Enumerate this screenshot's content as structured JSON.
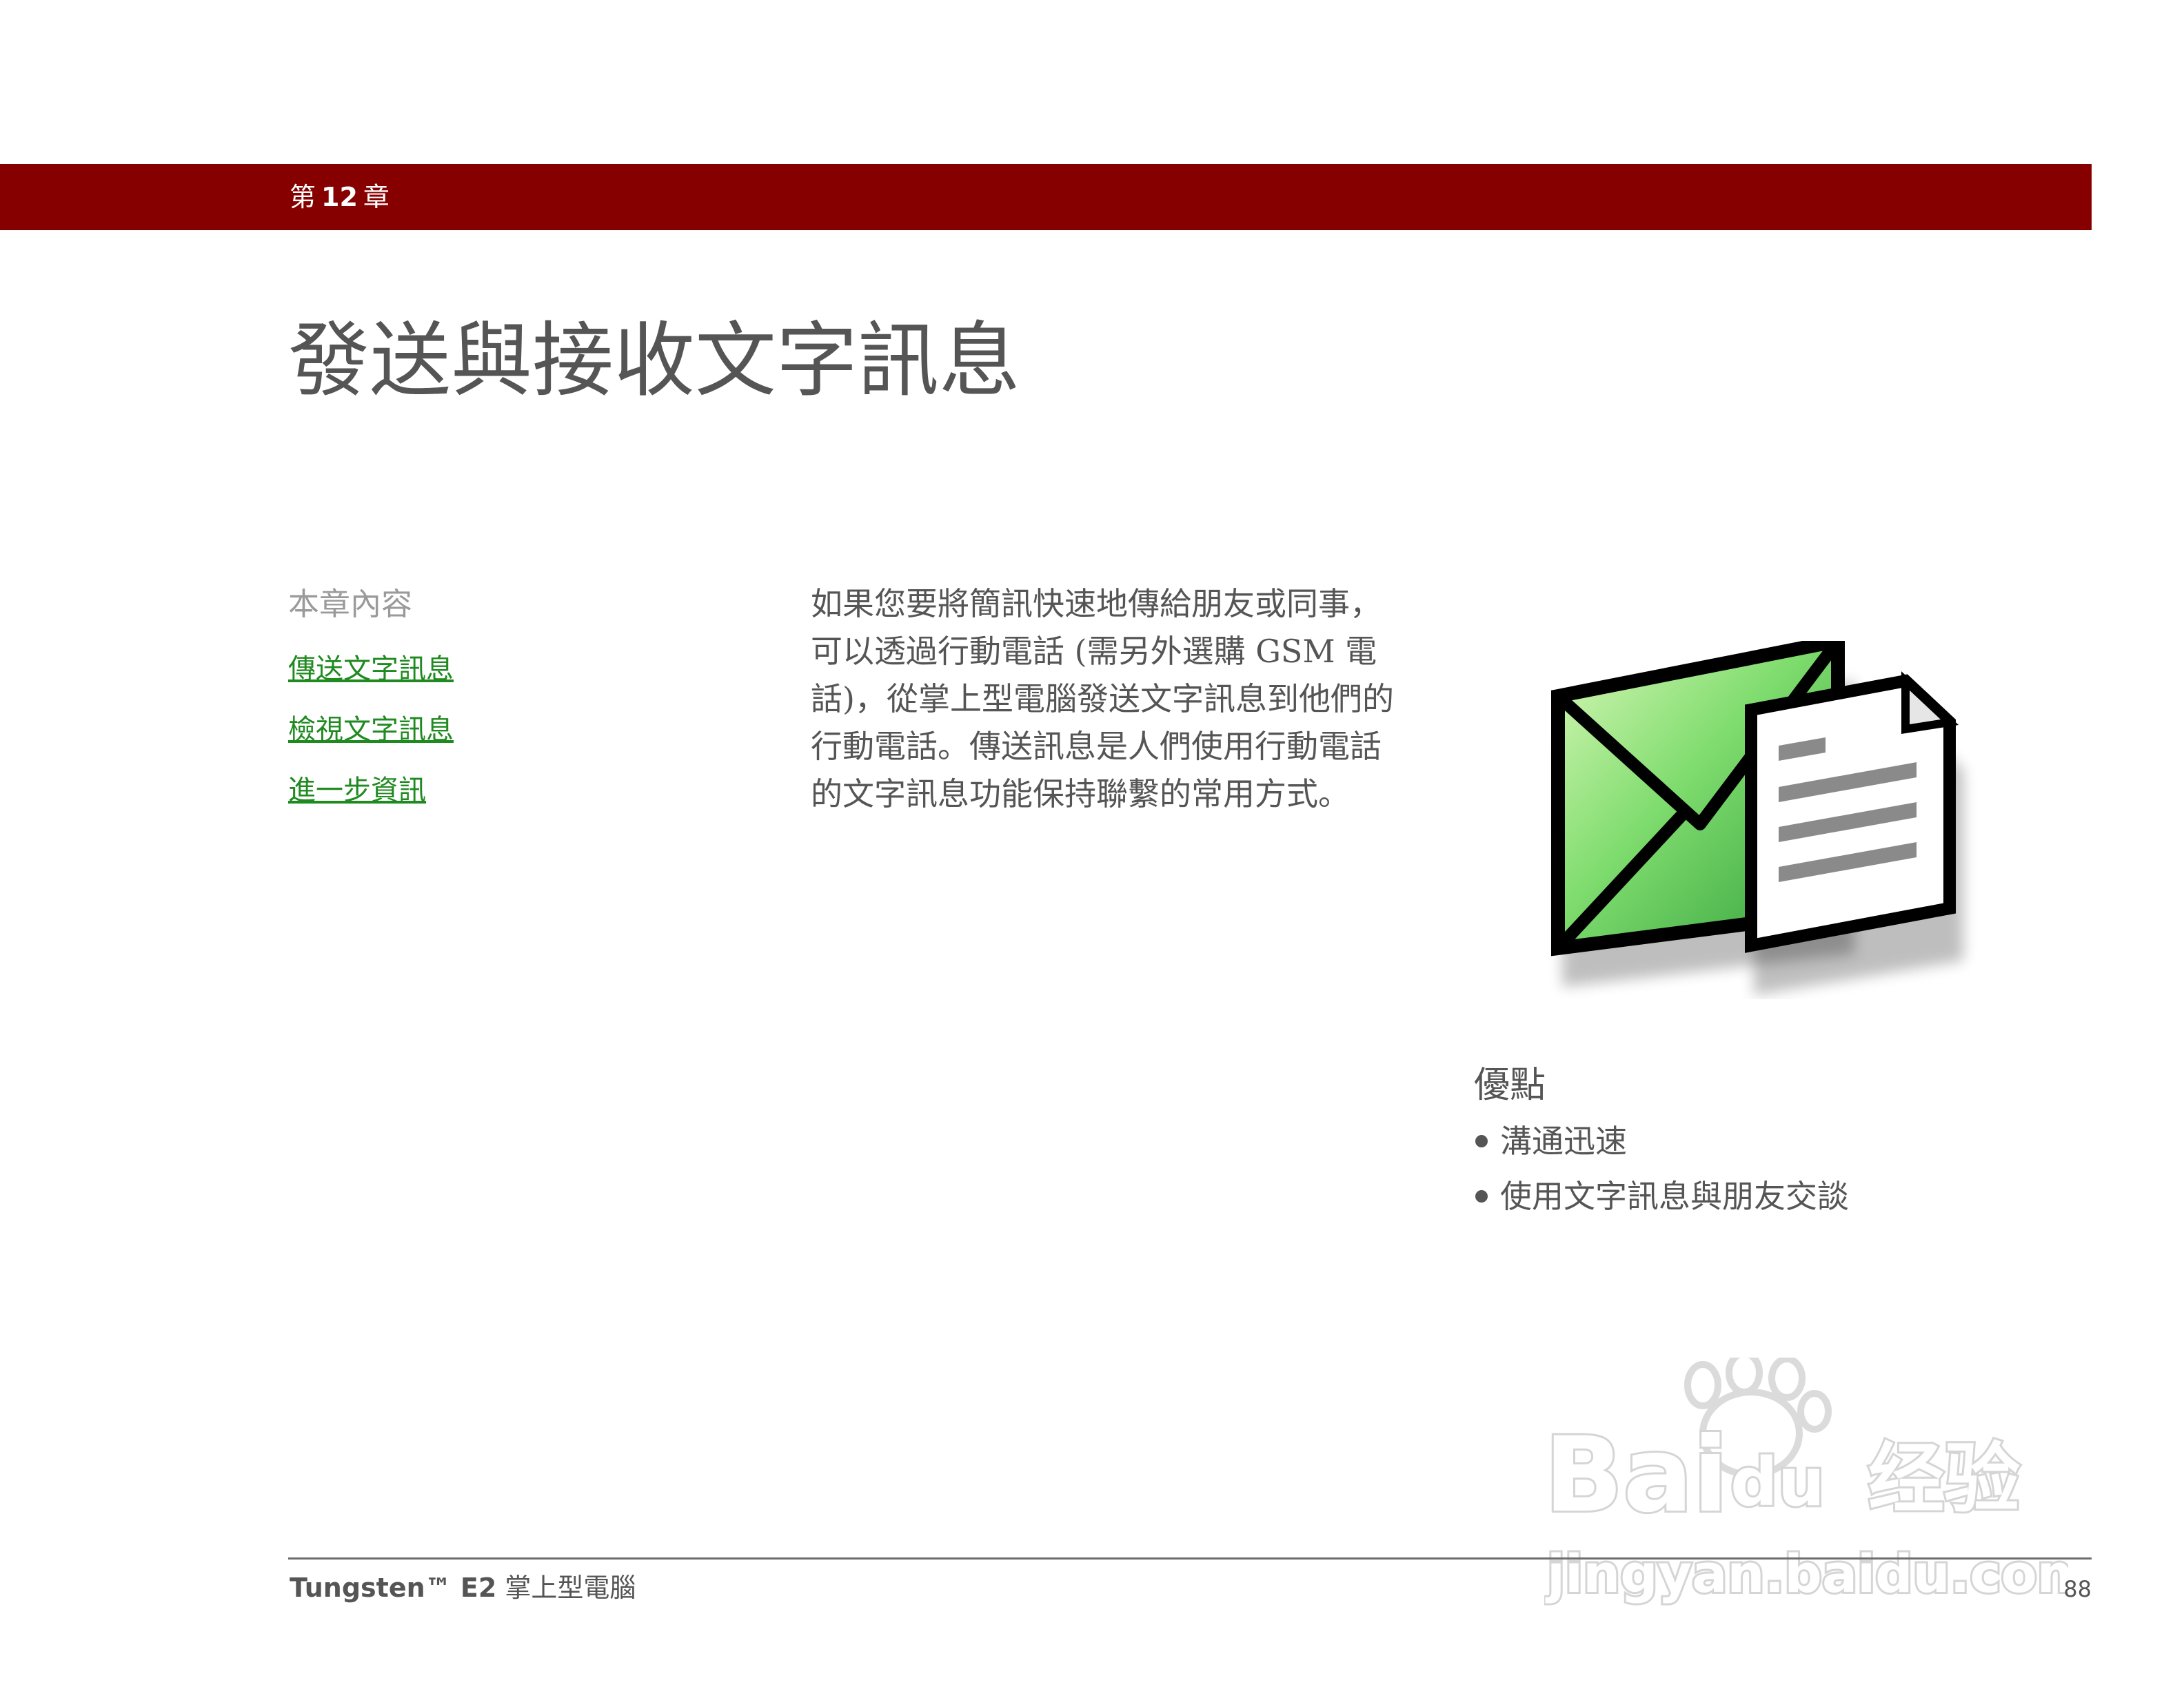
{
  "header": {
    "chapter_prefix": "第",
    "chapter_number": "12",
    "chapter_suffix": "章",
    "bar_color": "#860000"
  },
  "page_title": "發送與接收文字訊息",
  "toc": {
    "heading": "本章內容",
    "links": [
      "傳送文字訊息",
      "檢視文字訊息",
      "進一步資訊"
    ],
    "link_color": "#1f8a1f"
  },
  "intro": {
    "lines": [
      "如果您要將簡訊快速地傳給朋友或同事，",
      "可以透過行動電話 (需另外選購 GSM 電",
      "話)，從掌上型電腦發送文字訊息到他們的",
      "行動電話。傳送訊息是人們使用行動電話",
      "的文字訊息功能保持聯繫的常用方式。"
    ]
  },
  "illustration": {
    "icon": "envelope-document-icon"
  },
  "benefits": {
    "heading": "優點",
    "items": [
      "溝通迅速",
      "使用文字訊息與朋友交談"
    ]
  },
  "watermark": {
    "text_main": "Bai",
    "text_du": "du",
    "text_cn": "经验",
    "text_url": "jingyan.baidu.com"
  },
  "footer": {
    "brand": "Tungsten™ E2",
    "product": "掌上型電腦",
    "page_number": "88"
  }
}
